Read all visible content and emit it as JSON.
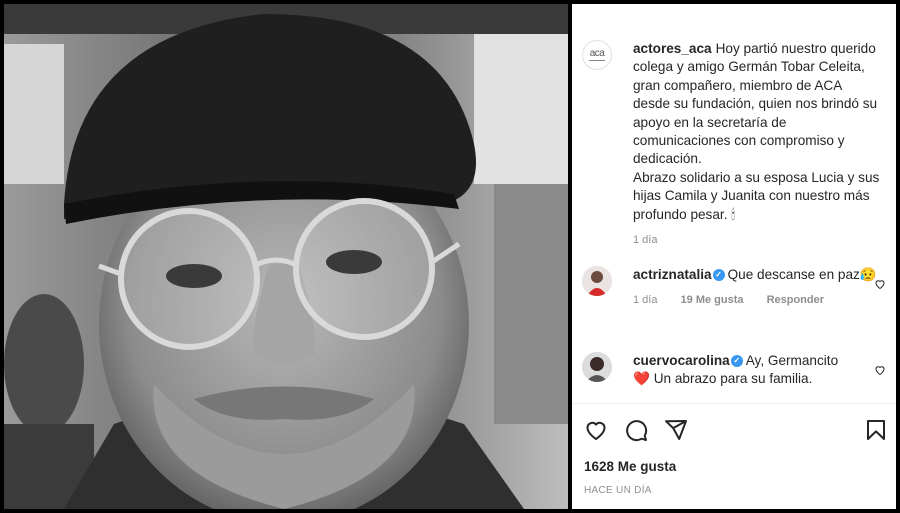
{
  "post": {
    "username": "actores_aca",
    "avatar_logo": "aca",
    "caption_para1": "Hoy partió nuestro querido colega y amigo Germán Tobar Celeita, gran compañero, miembro de ACA desde su fundación, quien nos brindó su apoyo en la secretaría de comunicaciones con compromiso y dedicación.",
    "caption_para2": "Abrazo solidario a su esposa Lucia y sus hijas Camila y Juanita con nuestro más profundo pesar. 🕯",
    "caption_time": "1 día"
  },
  "comments": [
    {
      "username": "actriznatalia",
      "text": "Que descanse en paz😥",
      "time": "1 día",
      "likes": "19 Me gusta",
      "reply": "Responder"
    },
    {
      "username": "cuervocarolina",
      "text": "Ay, Germancito",
      "text2": "❤️ Un abrazo para su familia."
    }
  ],
  "actions": {
    "icons": [
      "heart-icon",
      "comment-icon",
      "share-icon",
      "bookmark-icon"
    ]
  },
  "likes_count": "1628 Me gusta",
  "post_time": "HACE UN DÍA",
  "colors": {
    "verified": "#3897f0",
    "meta_gray": "#8e8e8e",
    "text": "#262626"
  }
}
